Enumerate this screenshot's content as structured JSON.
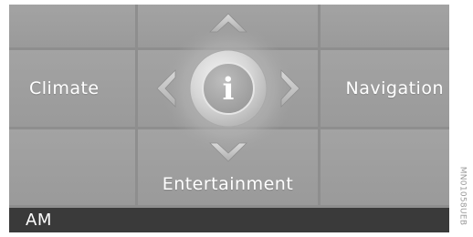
{
  "menu": {
    "climate_label": "Climate",
    "navigation_label": "Navigation",
    "entertainment_label": "Entertainment",
    "info_glyph": "i"
  },
  "status": {
    "text": "AM"
  },
  "figure_code": "MN01058UEB",
  "icons": [
    "info-icon",
    "arrow-up-icon",
    "arrow-down-icon",
    "arrow-left-icon",
    "arrow-right-icon"
  ],
  "colors": {
    "tile": "#a3a3a3",
    "grid_line": "#8e8e8e",
    "status_bar": "#3a3a3a",
    "label_text": "#ffffff"
  }
}
